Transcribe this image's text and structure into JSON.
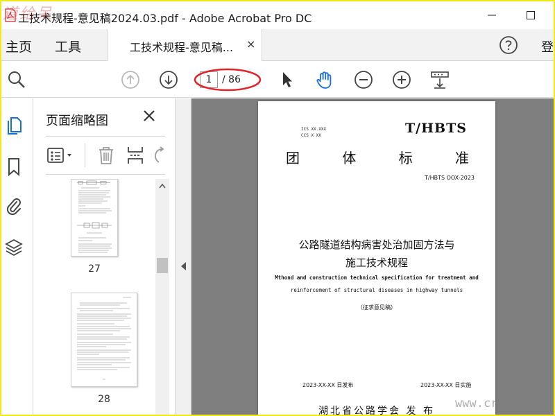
{
  "window": {
    "title": "工技术规程-意见稿2024.03.pdf - Adobe Acrobat Pro DC",
    "watermark_top": "道给呆",
    "watermark_bottom": "www.cr"
  },
  "menubar": {
    "home_label": "主页",
    "tools_label": "工具",
    "doc_tab_label": "工技术规程-意见稿...",
    "doc_tab_close": "×",
    "login_label": "登"
  },
  "toolbar": {
    "current_page": "1",
    "total_pages": "/ 86"
  },
  "thumbnail_panel": {
    "title": "页面缩略图",
    "pages": [
      {
        "number": "27"
      },
      {
        "number": "28"
      }
    ]
  },
  "document": {
    "ics_line": "ICS  XX.XXX",
    "ccs_line": "CCS  X XX",
    "brand": "T/HBTS",
    "std_title_chars": [
      "团",
      "体",
      "标",
      "准"
    ],
    "std_number": "T/HBTS OOX-2023",
    "cn_title_line1": "公路隧道结构病害处治加固方法与",
    "cn_title_line2": "施工技术规程",
    "en_title_line1": "Mthond and construction technical specification for treatment and",
    "en_title_line2": "reinforcement of structural diseases in highway tunnels",
    "draft_note": "（征求意见稿）",
    "publish_date": "2023-XX-XX 日发布",
    "impl_date": "2023-XX-XX 日实施",
    "publisher": "湖北省公路学会  发 布"
  },
  "colors": {
    "frame_yellow": "#f0e81a",
    "doc_background": "#7f7f7f",
    "accent_blue": "#1a6fd4",
    "annotation_red": "#e0242a"
  }
}
